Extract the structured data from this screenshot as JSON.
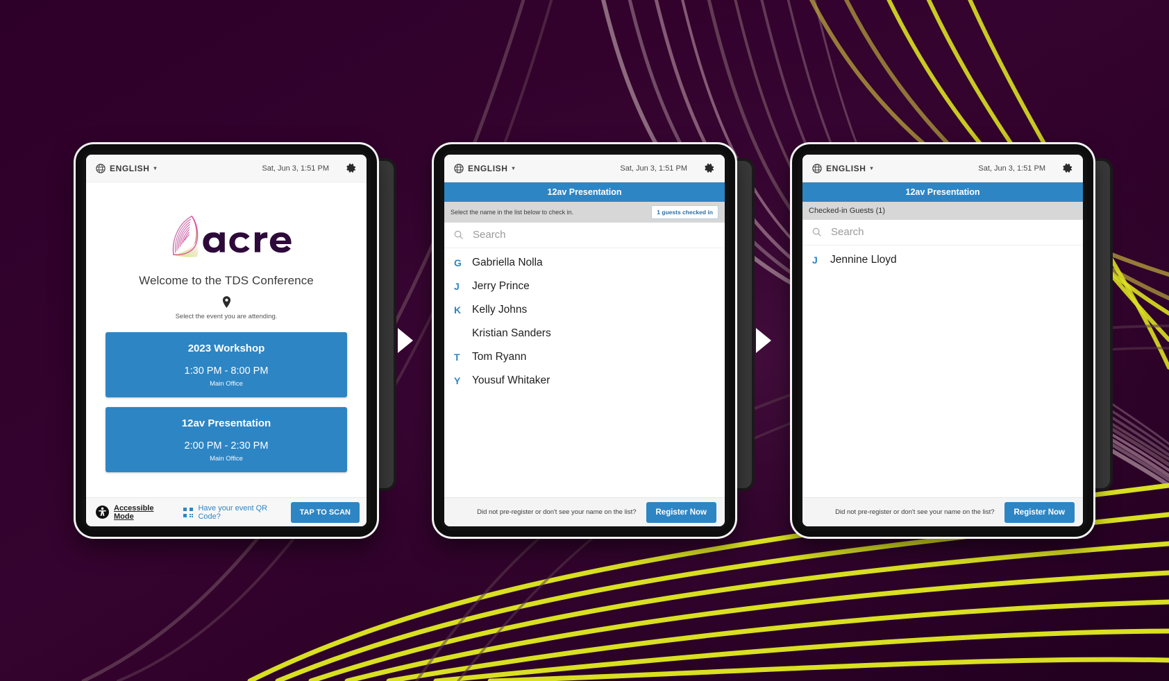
{
  "theme": {
    "bg_purple": "#2d0029",
    "accent_blue": "#2e85c3",
    "swirl_yellow": "#d9e021",
    "swirl_mauve": "#9b7d8c"
  },
  "statusbar": {
    "language": "ENGLISH",
    "caret": "▾",
    "clock": "Sat, Jun 3, 1:51 PM",
    "globe_icon": "globe-icon",
    "gear_icon": "gear-icon"
  },
  "screen1": {
    "brand": "acre",
    "welcome_title": "Welcome to the TDS Conference",
    "location_pin_icon": "location-pin-icon",
    "select_hint": "Select the event you are attending.",
    "events": [
      {
        "name": "2023 Workshop",
        "time": "1:30 PM - 8:00 PM",
        "room": "Main Office"
      },
      {
        "name": "12av Presentation",
        "time": "2:00 PM - 2:30 PM",
        "room": "Main Office"
      }
    ],
    "footer": {
      "accessible_icon": "accessibility-icon",
      "accessible_label": "Accessible Mode",
      "qr_icon": "qr-code-icon",
      "qr_question": "Have your event QR Code?",
      "scan_button": "TAP TO SCAN"
    }
  },
  "screen2": {
    "event_title": "12av Presentation",
    "instruction": "Select the name in the list below to check in.",
    "checked_badge": "1 guests checked in",
    "search_placeholder": "Search",
    "search_value": "",
    "search_icon": "search-icon",
    "guests": [
      {
        "initial": "G",
        "name": "Gabriella Nolla"
      },
      {
        "initial": "J",
        "name": "Jerry Prince"
      },
      {
        "initial": "K",
        "name": "Kelly Johns"
      },
      {
        "initial": "",
        "name": "Kristian Sanders"
      },
      {
        "initial": "T",
        "name": "Tom Ryann"
      },
      {
        "initial": "Y",
        "name": "Yousuf Whitaker"
      }
    ],
    "footer": {
      "prompt": "Did not pre-register or don't see your name on the list?",
      "register_button": "Register Now"
    }
  },
  "screen3": {
    "event_title": "12av Presentation",
    "subbar_title": "Checked-in Guests (1)",
    "search_placeholder": "Search",
    "search_value": "",
    "search_icon": "search-icon",
    "guests": [
      {
        "initial": "J",
        "name": "Jennine Lloyd"
      }
    ],
    "footer": {
      "prompt": "Did not pre-register or don't see your name on the list?",
      "register_button": "Register Now"
    }
  },
  "flow": {
    "arrow1_icon": "play-arrow-icon",
    "arrow2_icon": "play-arrow-icon"
  }
}
